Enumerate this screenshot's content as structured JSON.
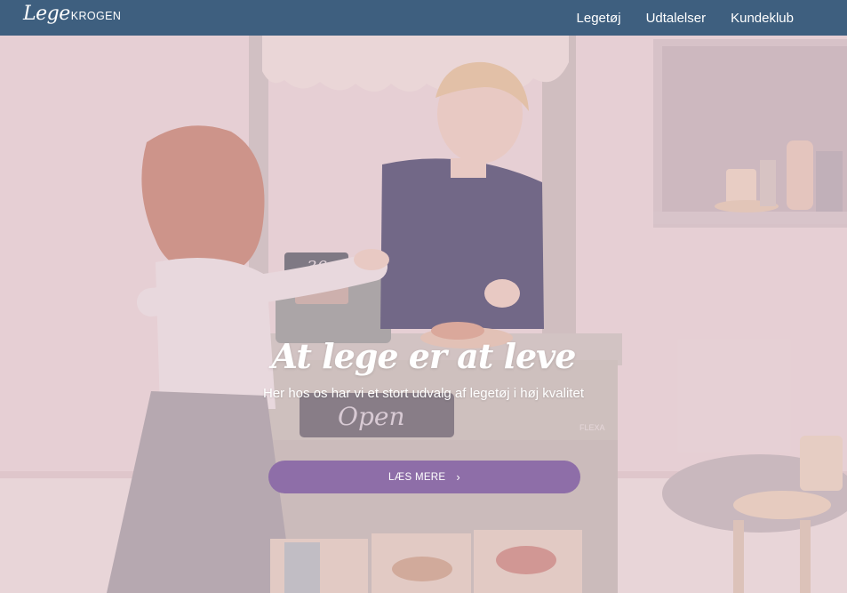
{
  "brand": {
    "logo_script": "Lege",
    "logo_caps": "KROGEN"
  },
  "nav": {
    "items": [
      {
        "label": "Legetøj"
      },
      {
        "label": "Udtalelser"
      },
      {
        "label": "Kundeklub"
      }
    ]
  },
  "hero": {
    "title": "At lege er at leve",
    "subtitle": "Her hos os har vi et stort udvalg af legetøj i høj kvalitet",
    "cta_label": "LÆS MERE",
    "cta_icon": "chevron-right-icon",
    "scene": {
      "register_price": "3€",
      "shop_sign": "Open",
      "stand_brand": "FLEXA"
    }
  },
  "colors": {
    "nav_bg": "#3e5f7f",
    "cta_bg": "#8e6ea8",
    "text_light": "#ffffff"
  }
}
